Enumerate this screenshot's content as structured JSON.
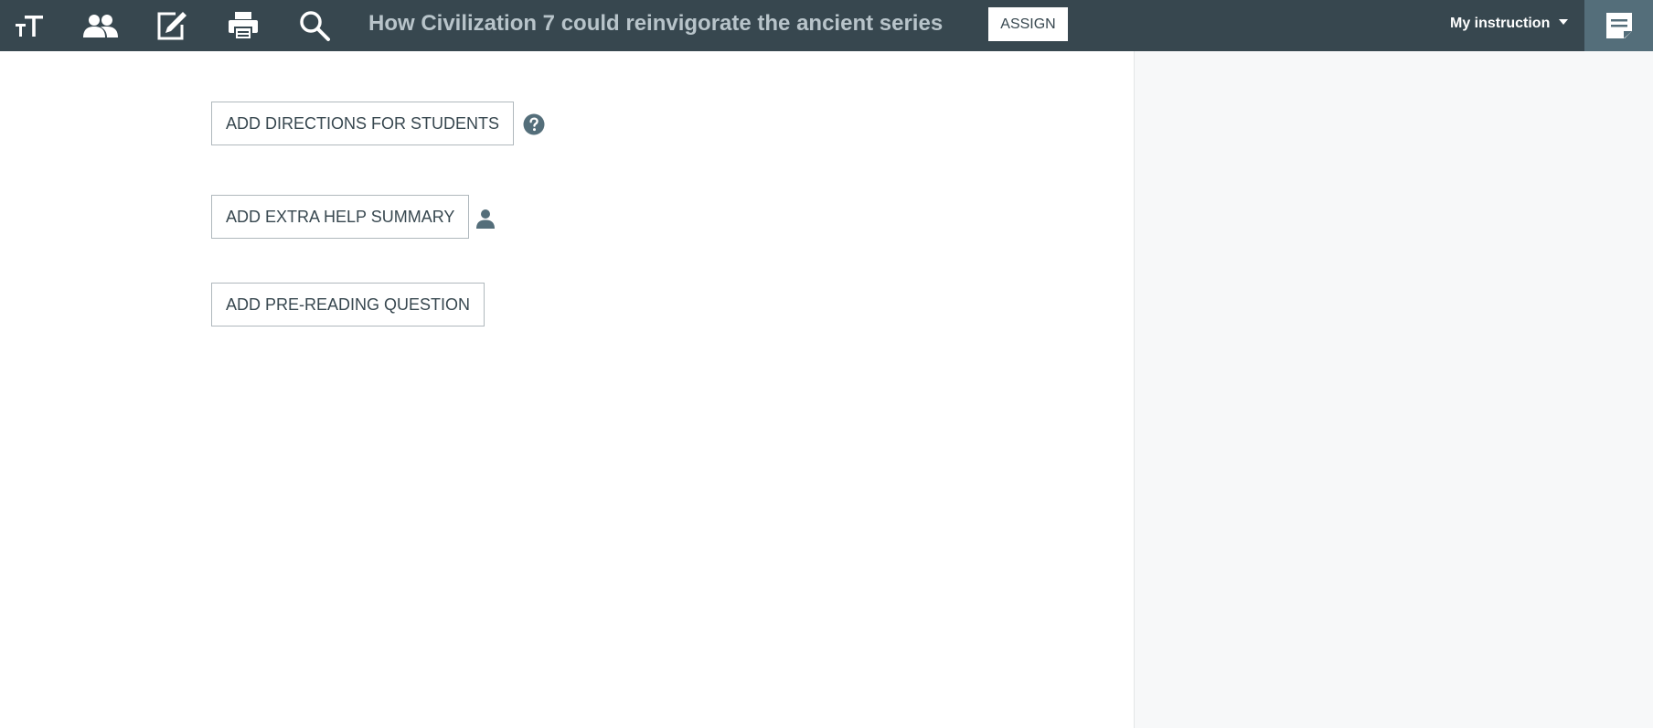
{
  "header": {
    "title": "How Civilization 7 could reinvigorate the ancient series",
    "assign_label": "ASSIGN",
    "instruction_label": "My instruction",
    "icons": [
      "text-size-icon",
      "people-icon",
      "edit-icon",
      "print-icon",
      "search-icon",
      "notes-icon"
    ]
  },
  "actions": {
    "directions_label": "ADD DIRECTIONS FOR STUDENTS",
    "summary_label": "ADD EXTRA HELP SUMMARY",
    "prereading_label": "ADD PRE-READING QUESTION"
  },
  "colors": {
    "topbar": "#37474f",
    "accent_tab": "#546e7a",
    "side_panel": "#f7f8f9",
    "title_text": "#b8c4ca",
    "button_text": "#37474f"
  }
}
